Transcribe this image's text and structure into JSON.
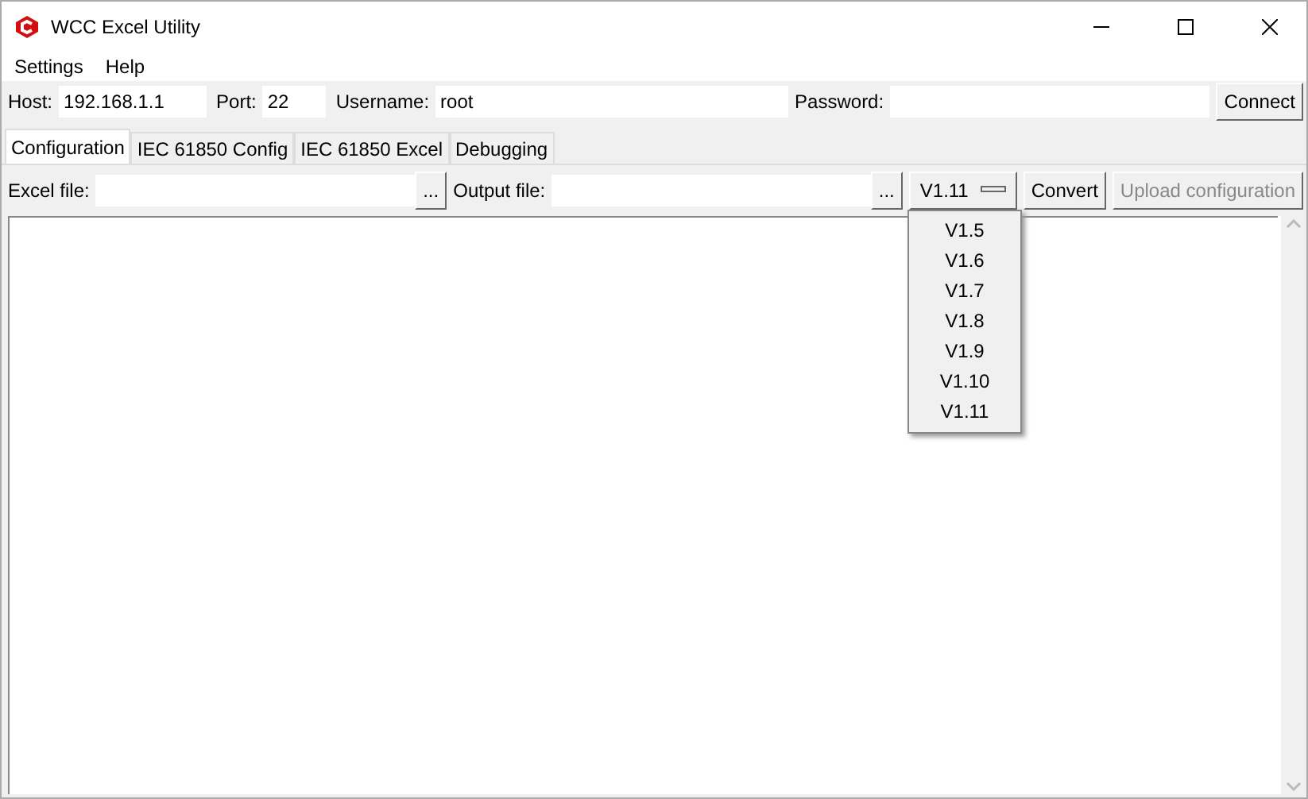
{
  "window": {
    "title": "WCC Excel Utility"
  },
  "menu": [
    "Settings",
    "Help"
  ],
  "connection": {
    "host_label": "Host:",
    "host": "192.168.1.1",
    "port_label": "Port:",
    "port": "22",
    "username_label": "Username:",
    "username": "root",
    "password_label": "Password:",
    "connect_button": "Connect"
  },
  "tabs": [
    {
      "label": "Configuration",
      "selected": true
    },
    {
      "label": "IEC 61850 Config",
      "selected": false
    },
    {
      "label": "IEC 61850 Excel",
      "selected": false
    },
    {
      "label": "Debugging",
      "selected": false
    }
  ],
  "file_row": {
    "excel_label": "Excel file:",
    "browse_excel": "...",
    "output_label": "Output file:",
    "browse_output": "...",
    "version": "V1.11",
    "buttons": [
      {
        "label": "Convert",
        "disabled": false
      },
      {
        "label": "Upload configuration",
        "disabled": true
      }
    ]
  },
  "version_dropdown": {
    "expanded": true,
    "options": [
      "V1.5",
      "V1.6",
      "V1.7",
      "V1.8",
      "V1.9",
      "V1.10",
      "V1.11"
    ]
  }
}
